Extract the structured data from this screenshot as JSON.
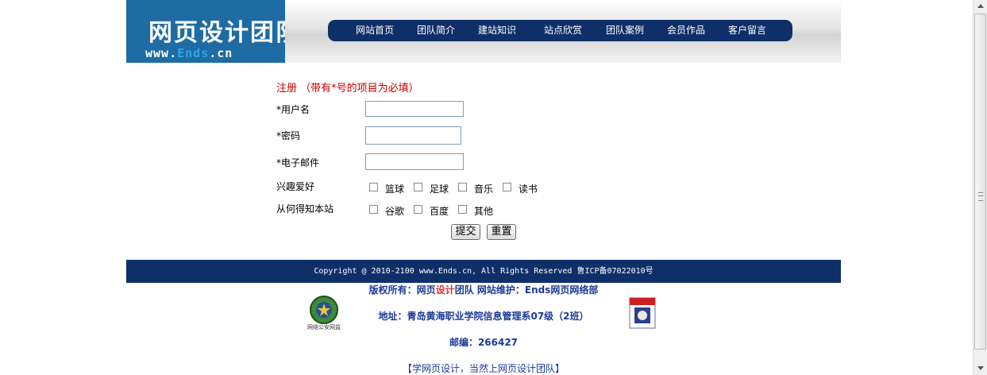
{
  "logo": {
    "title": "网页设计团队",
    "url_prefix": "www.",
    "url_highlight": "Ends",
    "url_suffix": ".cn"
  },
  "nav": {
    "items": [
      "网站首页",
      "团队简介",
      "建站知识",
      "站点欣赏",
      "团队案例",
      "会员作品",
      "客户留言"
    ]
  },
  "form": {
    "title": "注册 （带有*号的项目为必填）",
    "username_label": "*用户名",
    "password_label": "*密码",
    "email_label": "*电子邮件",
    "username_value": "",
    "password_value": "",
    "email_value": "",
    "hobbies_label": "兴趣爱好",
    "hobbies": [
      "篮球",
      "足球",
      "音乐",
      "读书"
    ],
    "source_label": "从何得知本站",
    "sources": [
      "谷歌",
      "百度",
      "其他"
    ],
    "submit_label": "提交",
    "reset_label": "重置"
  },
  "footer": {
    "copyright": "Copyright @ 2010-2100 www.Ends.cn, All Rights Reserved  鲁ICP备07022010号",
    "owner_prefix": "版权所有：网页",
    "owner_accent": "设计",
    "owner_suffix": "团队  网站维护：Ends网页网络部",
    "address": "地址：青岛黄海职业学院信息管理系07级（2班）",
    "postcode": "邮编：266427",
    "slogan": "【学网页设计，当然上网页设计团队】",
    "badge_left_text": "网络公安网监"
  },
  "colors": {
    "nav_bg": "#0f2f68",
    "logo_bg": "#1f6ba3",
    "title_red": "#cc0000",
    "footer_text": "#1a3a9a"
  }
}
